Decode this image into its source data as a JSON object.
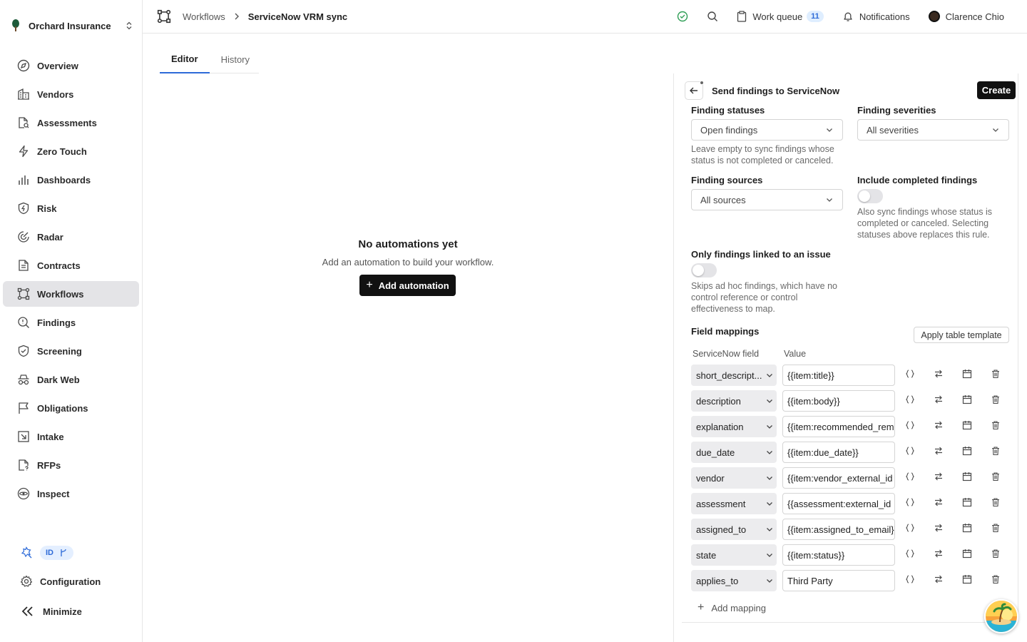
{
  "org": {
    "name": "Orchard Insurance"
  },
  "sidebar": {
    "items": [
      {
        "label": "Overview",
        "icon": "compass-icon"
      },
      {
        "label": "Vendors",
        "icon": "building-icon"
      },
      {
        "label": "Assessments",
        "icon": "file-search-icon"
      },
      {
        "label": "Zero Touch",
        "icon": "bolt-icon"
      },
      {
        "label": "Dashboards",
        "icon": "bar-chart-icon"
      },
      {
        "label": "Risk",
        "icon": "shield-bolt-icon"
      },
      {
        "label": "Radar",
        "icon": "radar-icon"
      },
      {
        "label": "Contracts",
        "icon": "document-icon"
      },
      {
        "label": "Workflows",
        "icon": "workflow-icon",
        "active": true
      },
      {
        "label": "Findings",
        "icon": "search-alert-icon"
      },
      {
        "label": "Screening",
        "icon": "shield-check-icon"
      },
      {
        "label": "Dark Web",
        "icon": "spy-icon"
      },
      {
        "label": "Obligations",
        "icon": "flag-icon"
      },
      {
        "label": "Intake",
        "icon": "inbox-arrow-icon"
      },
      {
        "label": "RFPs",
        "icon": "file-question-icon"
      },
      {
        "label": "Inspect",
        "icon": "eye-icon"
      }
    ],
    "tag_label": "ID",
    "configuration_label": "Configuration",
    "minimize_label": "Minimize"
  },
  "header": {
    "breadcrumb_root": "Workflows",
    "breadcrumb_current": "ServiceNow VRM sync",
    "work_queue_label": "Work queue",
    "work_queue_count": "11",
    "notifications_label": "Notifications",
    "user_name": "Clarence Chio"
  },
  "tabs": [
    "Editor",
    "History"
  ],
  "empty_state": {
    "title": "No automations yet",
    "subtitle": "Add an automation to build your workflow.",
    "button": "Add automation"
  },
  "panel": {
    "title": "Send findings to ServiceNow",
    "create_label": "Create",
    "finding_statuses": {
      "label": "Finding statuses",
      "value": "Open findings",
      "help": "Leave empty to sync findings whose status is not completed or canceled."
    },
    "finding_severities": {
      "label": "Finding severities",
      "value": "All severities"
    },
    "finding_sources": {
      "label": "Finding sources",
      "value": "All sources"
    },
    "include_completed": {
      "label": "Include completed findings",
      "enabled": false,
      "help": "Also sync findings whose status is completed or canceled. Selecting statuses above replaces this rule."
    },
    "linked_issue": {
      "label": "Only findings linked to an issue",
      "enabled": false,
      "help": "Skips ad hoc findings, which have no control reference or control effectiveness to map."
    },
    "field_mappings": {
      "label": "Field mappings",
      "apply_template_label": "Apply table template",
      "col_field": "ServiceNow field",
      "col_value": "Value",
      "rows": [
        {
          "field": "short_descript...",
          "value": "{{item:title}}"
        },
        {
          "field": "description",
          "value": "{{item:body}}"
        },
        {
          "field": "explanation",
          "value": "{{item:recommended_rem"
        },
        {
          "field": "due_date",
          "value": "{{item:due_date}}"
        },
        {
          "field": "vendor",
          "value": "{{item:vendor_external_id"
        },
        {
          "field": "assessment",
          "value": "{{assessment:external_id"
        },
        {
          "field": "assigned_to",
          "value": "{{item:assigned_to_email}}"
        },
        {
          "field": "state",
          "value": "{{item:status}}"
        },
        {
          "field": "applies_to",
          "value": "Third Party"
        }
      ],
      "add_label": "Add mapping"
    }
  },
  "colors": {
    "accent": "#2e6bd8",
    "primary_button": "#111111",
    "active_nav": "#e4e4e7",
    "status_ok": "#2e9e55"
  }
}
